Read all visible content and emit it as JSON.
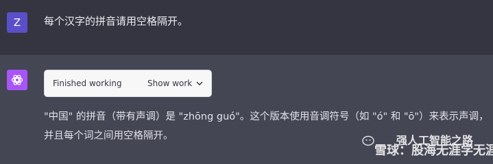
{
  "user_message": {
    "avatar_letter": "Z",
    "text": "每个汉字的拼音请用空格隔开。"
  },
  "assistant_message": {
    "work_status": "Finished working",
    "show_work_label": "Show work",
    "reply_text": "\"中国\" 的拼音（带有声调）是 \"zhōng guó\"。这个版本使用音调符号（如 \"ó\" 和 \"ō\"）来表示声调，并且每个词之间用空格隔开。"
  },
  "watermark": {
    "line1": "强人工智能之路",
    "line2": "雪球：股海无涯学无涯"
  },
  "colors": {
    "user_bg": "#343541",
    "assistant_bg": "#444654",
    "user_avatar": "#5b4fc9",
    "bot_avatar": "#a855f7"
  }
}
